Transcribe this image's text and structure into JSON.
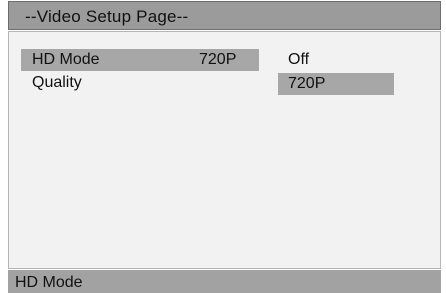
{
  "title_bar": {
    "title": "--Video Setup Page--"
  },
  "menu": {
    "items": [
      {
        "label": "HD Mode",
        "value": "720P",
        "selected": true
      },
      {
        "label": "Quality",
        "value": "",
        "selected": false
      }
    ]
  },
  "options": {
    "items": [
      {
        "label": "Off",
        "highlighted": false
      },
      {
        "label": "720P",
        "highlighted": true
      }
    ]
  },
  "status_bar": {
    "text": "HD Mode"
  },
  "colors": {
    "title_bar": "#9b9b9b",
    "panel": "#f2f2f2",
    "highlight": "#a7a7a7",
    "status_bar": "#a2a2a2"
  }
}
